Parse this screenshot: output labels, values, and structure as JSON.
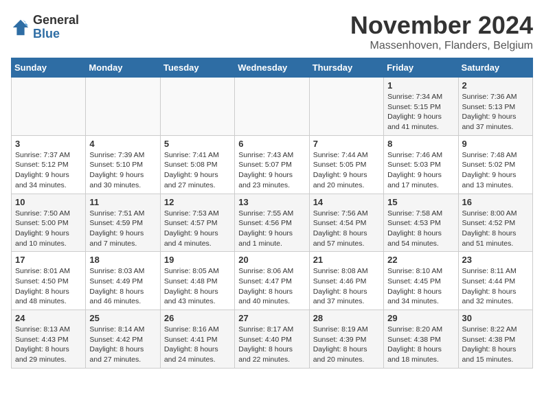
{
  "logo": {
    "general": "General",
    "blue": "Blue"
  },
  "header": {
    "month_year": "November 2024",
    "location": "Massenhoven, Flanders, Belgium"
  },
  "weekdays": [
    "Sunday",
    "Monday",
    "Tuesday",
    "Wednesday",
    "Thursday",
    "Friday",
    "Saturday"
  ],
  "weeks": [
    [
      {
        "day": "",
        "info": ""
      },
      {
        "day": "",
        "info": ""
      },
      {
        "day": "",
        "info": ""
      },
      {
        "day": "",
        "info": ""
      },
      {
        "day": "",
        "info": ""
      },
      {
        "day": "1",
        "info": "Sunrise: 7:34 AM\nSunset: 5:15 PM\nDaylight: 9 hours\nand 41 minutes."
      },
      {
        "day": "2",
        "info": "Sunrise: 7:36 AM\nSunset: 5:13 PM\nDaylight: 9 hours\nand 37 minutes."
      }
    ],
    [
      {
        "day": "3",
        "info": "Sunrise: 7:37 AM\nSunset: 5:12 PM\nDaylight: 9 hours\nand 34 minutes."
      },
      {
        "day": "4",
        "info": "Sunrise: 7:39 AM\nSunset: 5:10 PM\nDaylight: 9 hours\nand 30 minutes."
      },
      {
        "day": "5",
        "info": "Sunrise: 7:41 AM\nSunset: 5:08 PM\nDaylight: 9 hours\nand 27 minutes."
      },
      {
        "day": "6",
        "info": "Sunrise: 7:43 AM\nSunset: 5:07 PM\nDaylight: 9 hours\nand 23 minutes."
      },
      {
        "day": "7",
        "info": "Sunrise: 7:44 AM\nSunset: 5:05 PM\nDaylight: 9 hours\nand 20 minutes."
      },
      {
        "day": "8",
        "info": "Sunrise: 7:46 AM\nSunset: 5:03 PM\nDaylight: 9 hours\nand 17 minutes."
      },
      {
        "day": "9",
        "info": "Sunrise: 7:48 AM\nSunset: 5:02 PM\nDaylight: 9 hours\nand 13 minutes."
      }
    ],
    [
      {
        "day": "10",
        "info": "Sunrise: 7:50 AM\nSunset: 5:00 PM\nDaylight: 9 hours\nand 10 minutes."
      },
      {
        "day": "11",
        "info": "Sunrise: 7:51 AM\nSunset: 4:59 PM\nDaylight: 9 hours\nand 7 minutes."
      },
      {
        "day": "12",
        "info": "Sunrise: 7:53 AM\nSunset: 4:57 PM\nDaylight: 9 hours\nand 4 minutes."
      },
      {
        "day": "13",
        "info": "Sunrise: 7:55 AM\nSunset: 4:56 PM\nDaylight: 9 hours\nand 1 minute."
      },
      {
        "day": "14",
        "info": "Sunrise: 7:56 AM\nSunset: 4:54 PM\nDaylight: 8 hours\nand 57 minutes."
      },
      {
        "day": "15",
        "info": "Sunrise: 7:58 AM\nSunset: 4:53 PM\nDaylight: 8 hours\nand 54 minutes."
      },
      {
        "day": "16",
        "info": "Sunrise: 8:00 AM\nSunset: 4:52 PM\nDaylight: 8 hours\nand 51 minutes."
      }
    ],
    [
      {
        "day": "17",
        "info": "Sunrise: 8:01 AM\nSunset: 4:50 PM\nDaylight: 8 hours\nand 48 minutes."
      },
      {
        "day": "18",
        "info": "Sunrise: 8:03 AM\nSunset: 4:49 PM\nDaylight: 8 hours\nand 46 minutes."
      },
      {
        "day": "19",
        "info": "Sunrise: 8:05 AM\nSunset: 4:48 PM\nDaylight: 8 hours\nand 43 minutes."
      },
      {
        "day": "20",
        "info": "Sunrise: 8:06 AM\nSunset: 4:47 PM\nDaylight: 8 hours\nand 40 minutes."
      },
      {
        "day": "21",
        "info": "Sunrise: 8:08 AM\nSunset: 4:46 PM\nDaylight: 8 hours\nand 37 minutes."
      },
      {
        "day": "22",
        "info": "Sunrise: 8:10 AM\nSunset: 4:45 PM\nDaylight: 8 hours\nand 34 minutes."
      },
      {
        "day": "23",
        "info": "Sunrise: 8:11 AM\nSunset: 4:44 PM\nDaylight: 8 hours\nand 32 minutes."
      }
    ],
    [
      {
        "day": "24",
        "info": "Sunrise: 8:13 AM\nSunset: 4:43 PM\nDaylight: 8 hours\nand 29 minutes."
      },
      {
        "day": "25",
        "info": "Sunrise: 8:14 AM\nSunset: 4:42 PM\nDaylight: 8 hours\nand 27 minutes."
      },
      {
        "day": "26",
        "info": "Sunrise: 8:16 AM\nSunset: 4:41 PM\nDaylight: 8 hours\nand 24 minutes."
      },
      {
        "day": "27",
        "info": "Sunrise: 8:17 AM\nSunset: 4:40 PM\nDaylight: 8 hours\nand 22 minutes."
      },
      {
        "day": "28",
        "info": "Sunrise: 8:19 AM\nSunset: 4:39 PM\nDaylight: 8 hours\nand 20 minutes."
      },
      {
        "day": "29",
        "info": "Sunrise: 8:20 AM\nSunset: 4:38 PM\nDaylight: 8 hours\nand 18 minutes."
      },
      {
        "day": "30",
        "info": "Sunrise: 8:22 AM\nSunset: 4:38 PM\nDaylight: 8 hours\nand 15 minutes."
      }
    ]
  ]
}
